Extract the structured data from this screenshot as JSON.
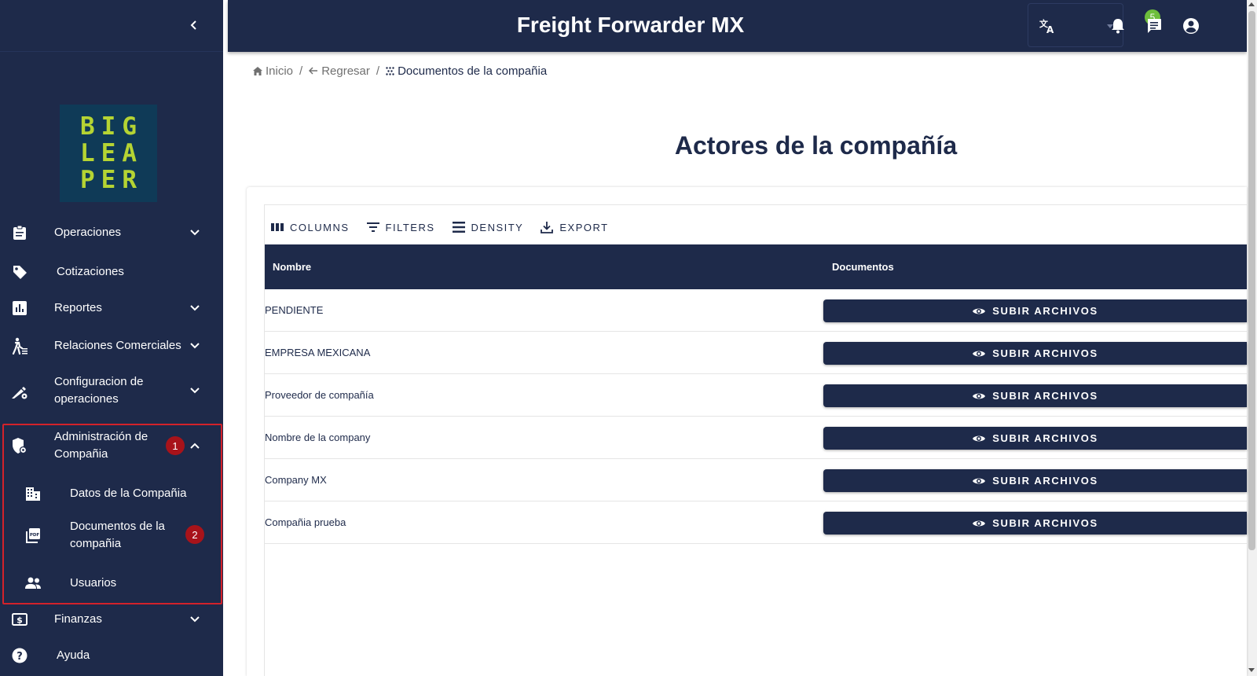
{
  "header": {
    "title": "Freight Forwarder MX",
    "notification_count": "5"
  },
  "sidebar": {
    "logo_lines": [
      "BIG",
      "LEA",
      "PER"
    ],
    "items": [
      {
        "label": "Operaciones"
      },
      {
        "label": "Cotizaciones"
      },
      {
        "label": "Reportes"
      },
      {
        "label": "Relaciones Comerciales"
      },
      {
        "label_line1": "Configuracion de",
        "label_line2": "operaciones"
      },
      {
        "label_line1": "Administración de",
        "label_line2": "Compañia",
        "step": "1"
      },
      {
        "label": "Finanzas"
      },
      {
        "label": "Ayuda"
      }
    ],
    "subitems": [
      {
        "label": "Datos de la Compañia"
      },
      {
        "label_line1": "Documentos de la",
        "label_line2": "compañia",
        "step": "2"
      },
      {
        "label": "Usuarios"
      }
    ]
  },
  "breadcrumb": {
    "home": "Inicio",
    "back": "Regresar",
    "current": "Documentos de la compañia",
    "sep": "/"
  },
  "page": {
    "title": "Actores de la compañía"
  },
  "toolbar": {
    "columns": "COLUMNS",
    "filters": "FILTERS",
    "density": "DENSITY",
    "export": "EXPORT"
  },
  "table": {
    "headers": [
      "Nombre",
      "Documentos"
    ],
    "button_label": "SUBIR ARCHIVOS",
    "rows": [
      {
        "name": "PENDIENTE"
      },
      {
        "name": "EMPRESA MEXICANA"
      },
      {
        "name": "Proveedor de compañía"
      },
      {
        "name": "Nombre de la company"
      },
      {
        "name": "Company MX"
      },
      {
        "name": "Compañia prueba"
      }
    ]
  },
  "colors": {
    "primary": "#1e2a4a",
    "highlight": "#d3222a",
    "step_badge": "#a8131a",
    "notification_badge": "#6ebe3c",
    "logo_text": "#b5d433",
    "logo_bg": "#0f3a57"
  }
}
